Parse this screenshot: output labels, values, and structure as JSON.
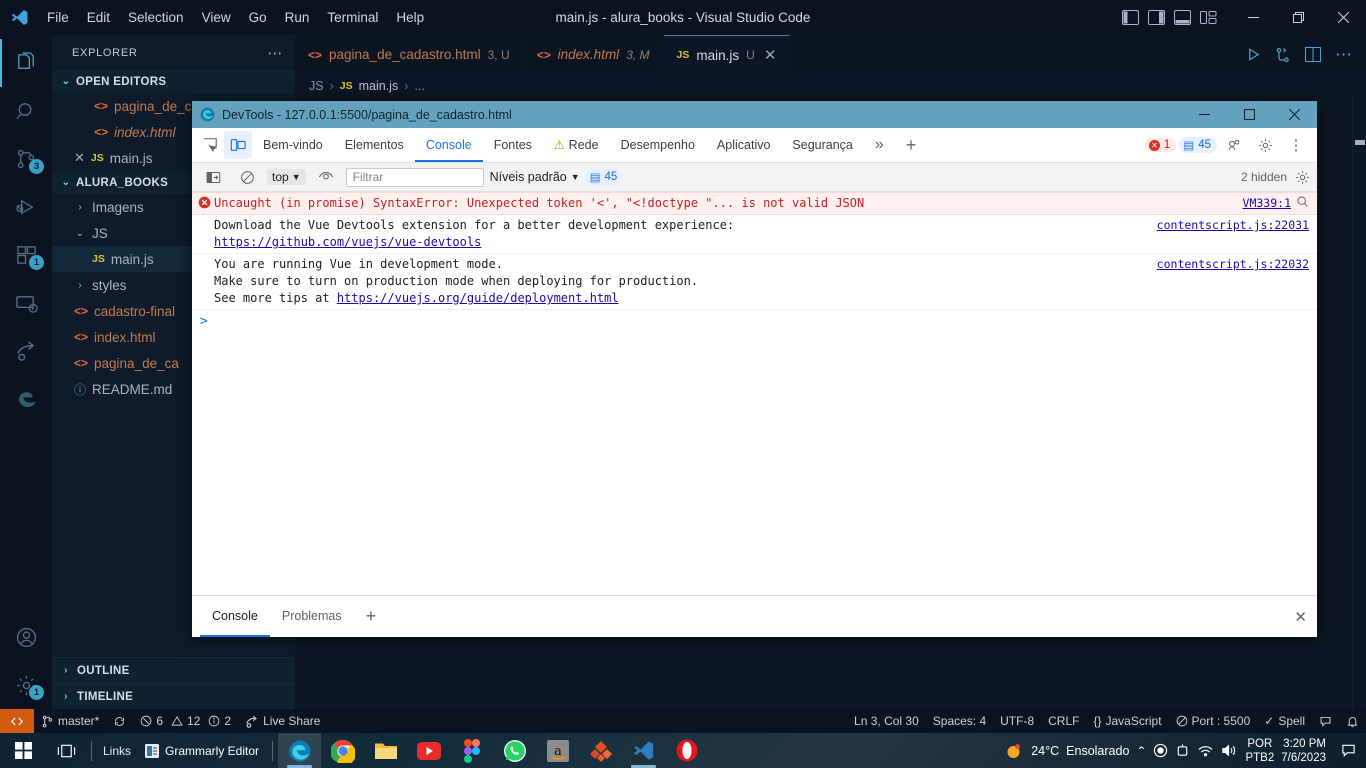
{
  "vscode": {
    "window_title": "main.js - alura_books - Visual Studio Code",
    "menu": [
      "File",
      "Edit",
      "Selection",
      "View",
      "Go",
      "Run",
      "Terminal",
      "Help"
    ],
    "window_controls": {
      "minimize": "—",
      "maximize": "❐",
      "close": "✕"
    },
    "activity_bar": [
      {
        "name": "explorer",
        "badge": ""
      },
      {
        "name": "search",
        "badge": ""
      },
      {
        "name": "source-control",
        "badge": "3"
      },
      {
        "name": "run-and-debug",
        "badge": ""
      },
      {
        "name": "extensions",
        "badge": "1"
      },
      {
        "name": "remote-explorer",
        "badge": ""
      },
      {
        "name": "live-share",
        "badge": ""
      },
      {
        "name": "edge-tools",
        "badge": ""
      },
      {
        "name": "accounts",
        "badge": ""
      },
      {
        "name": "manage-settings",
        "badge": "1"
      }
    ],
    "sidebar": {
      "title": "EXPLORER",
      "more_actions": "⋯",
      "open_editors": {
        "label": "OPEN EDITORS",
        "items": [
          {
            "name": "pagina_de_cadastro.html",
            "badge": "",
            "icon": "html-icon",
            "italic": false
          },
          {
            "name": "index.html",
            "badge": "",
            "icon": "html-icon",
            "italic": true
          },
          {
            "name": "main.js",
            "badge": "",
            "icon": "js-icon",
            "italic": false
          }
        ]
      },
      "workspace": {
        "label": "ALURA_BOOKS",
        "items": [
          {
            "name": "Imagens",
            "type": "folder",
            "expanded": false,
            "indent": 1
          },
          {
            "name": "JS",
            "type": "folder",
            "expanded": true,
            "indent": 1
          },
          {
            "name": "main.js",
            "type": "js",
            "indent": 2,
            "selected": true
          },
          {
            "name": "styles",
            "type": "folder",
            "expanded": false,
            "indent": 1
          },
          {
            "name": "cadastro-final",
            "type": "html",
            "indent": 1
          },
          {
            "name": "index.html",
            "type": "html",
            "indent": 1
          },
          {
            "name": "pagina_de_ca",
            "type": "html",
            "indent": 1
          },
          {
            "name": "README.md",
            "type": "md",
            "indent": 1
          }
        ]
      },
      "outline_label": "OUTLINE",
      "timeline_label": "TIMELINE"
    },
    "tabs": [
      {
        "label": "pagina_de_cadastro.html",
        "badge": "3, U",
        "icon": "html-icon",
        "active": false,
        "italic": false,
        "closable": false
      },
      {
        "label": "index.html",
        "badge": "3, M",
        "icon": "html-icon",
        "active": false,
        "italic": true,
        "closable": false
      },
      {
        "label": "main.js",
        "badge": "U",
        "icon": "js-icon",
        "active": true,
        "italic": false,
        "closable": true
      }
    ],
    "breadcrumb": [
      "JS",
      "main.js",
      "..."
    ],
    "editor_actions": [
      "run-icon",
      "source-control-icon",
      "split-editor-icon",
      "more-actions-icon"
    ],
    "statusbar": {
      "remote_icon": "remote-indicator",
      "branch": "master*",
      "sync_icon": "sync-icon",
      "errors": "6",
      "warnings": "12",
      "infos": "2",
      "live_share": "Live Share",
      "position": "Ln 3, Col 30",
      "spaces": "Spaces: 4",
      "encoding": "UTF-8",
      "eol": "CRLF",
      "language": "JavaScript",
      "port": "Port : 5500",
      "spell": "Spell"
    }
  },
  "devtools": {
    "title": "DevTools - 127.0.0.1:5500/pagina_de_cadastro.html",
    "window_controls": {
      "minimize": "—",
      "maximize": "❐",
      "close": "✕"
    },
    "tabs": [
      {
        "label": "Bem-vindo",
        "active": false,
        "warning": false
      },
      {
        "label": "Elementos",
        "active": false,
        "warning": false
      },
      {
        "label": "Console",
        "active": true,
        "warning": false
      },
      {
        "label": "Fontes",
        "active": false,
        "warning": false
      },
      {
        "label": "Rede",
        "active": false,
        "warning": true
      },
      {
        "label": "Desempenho",
        "active": false,
        "warning": false
      },
      {
        "label": "Aplicativo",
        "active": false,
        "warning": false
      },
      {
        "label": "Segurança",
        "active": false,
        "warning": false
      }
    ],
    "more_tabs": "»",
    "add_tab": "+",
    "error_count": "1",
    "info_count": "45",
    "filter_bar": {
      "context": "top",
      "filter_placeholder": "Filtrar",
      "levels": "Níveis padrão",
      "message_count": "45",
      "hidden": "2 hidden"
    },
    "messages": [
      {
        "type": "error",
        "text": "Uncaught (in promise) SyntaxError: Unexpected token '<', \"<!doctype \"... is not valid JSON",
        "source": "VM339:1",
        "has_search": true
      },
      {
        "type": "info",
        "lines": [
          {
            "text": "Download the Vue Devtools extension for a better development experience:",
            "link": false
          },
          {
            "text": "https://github.com/vuejs/vue-devtools",
            "link": true
          }
        ],
        "source": "contentscript.js:22031"
      },
      {
        "type": "info",
        "lines": [
          {
            "text": "You are running Vue in development mode.",
            "link": false
          },
          {
            "text": "Make sure to turn on production mode when deploying for production.",
            "link": false
          },
          {
            "text": "See more tips at ",
            "link": false,
            "suffix_link": "https://vuejs.org/guide/deployment.html"
          }
        ],
        "source": "contentscript.js:22032"
      }
    ],
    "prompt": ">",
    "drawer_tabs": [
      {
        "label": "Console",
        "active": true
      },
      {
        "label": "Problemas",
        "active": false
      }
    ],
    "drawer_add": "+",
    "drawer_close": "✕"
  },
  "taskbar": {
    "links_label": "Links",
    "grammarly_label": "Grammarly Editor",
    "apps": [
      {
        "name": "edge",
        "running": true,
        "active": true
      },
      {
        "name": "chrome",
        "running": false,
        "active": false
      },
      {
        "name": "file-explorer",
        "running": false,
        "active": false
      },
      {
        "name": "youtube",
        "running": false,
        "active": false
      },
      {
        "name": "figma",
        "running": false,
        "active": false
      },
      {
        "name": "whatsapp",
        "running": false,
        "active": false
      },
      {
        "name": "amazon",
        "running": false,
        "active": false
      },
      {
        "name": "adobe",
        "running": false,
        "active": false
      },
      {
        "name": "vscode",
        "running": true,
        "active": false
      },
      {
        "name": "opera",
        "running": false,
        "active": false
      }
    ],
    "weather_temp": "24°C",
    "weather_desc": "Ensolarado",
    "lang_top": "POR",
    "lang_bottom": "PTB2",
    "time": "3:20 PM",
    "date": "7/6/2023"
  },
  "colors": {
    "accent_blue": "#1a73e8",
    "error_red": "#c5221f",
    "vs_blue": "#45b8d8",
    "orange": "#d15a0f",
    "devtools_title": "#65a2bd"
  }
}
